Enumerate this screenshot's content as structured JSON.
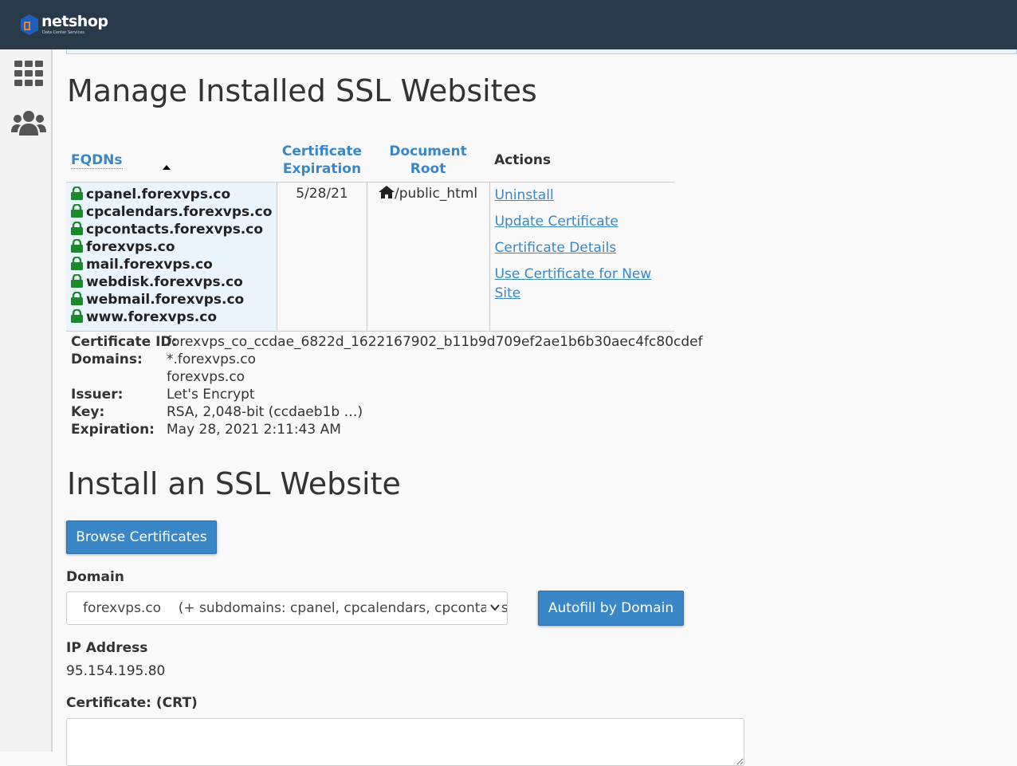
{
  "brand": {
    "name": "netshop",
    "tagline": "Data Center Services",
    "accent_color": "#3a87c8",
    "topbar_color": "#293a4a"
  },
  "sidebar": {
    "items": [
      {
        "icon": "grid-icon"
      },
      {
        "icon": "users-icon"
      }
    ]
  },
  "page": {
    "title": "Manage Installed SSL Websites",
    "install_title": "Install an SSL Website"
  },
  "table": {
    "headers": {
      "fqdns": "FQDNs",
      "expiration": "Certificate Expiration",
      "document_root": "Document Root",
      "actions": "Actions"
    },
    "row": {
      "fqdns": [
        "cpanel.forexvps.co",
        "cpcalendars.forexvps.co",
        "cpcontacts.forexvps.co",
        "forexvps.co",
        "mail.forexvps.co",
        "webdisk.forexvps.co",
        "webmail.forexvps.co",
        "www.forexvps.co"
      ],
      "expiration": "5/28/21",
      "document_root": "/public_html",
      "actions": [
        "Uninstall",
        "Update Certificate",
        "Certificate Details",
        "Use Certificate for New Site"
      ]
    }
  },
  "cert": {
    "id_label": "Certificate ID:",
    "id_value": "forexvps_co_ccdae_6822d_1622167902_b11b9d709ef2ae1b6b30aec4fc80cdef",
    "domains_label": "Domains:",
    "domains": [
      "*.forexvps.co",
      "forexvps.co"
    ],
    "issuer_label": "Issuer:",
    "issuer_value": "Let's Encrypt",
    "key_label": "Key:",
    "key_value": "RSA, 2,048-bit (ccdaeb1b …)",
    "expiration_label": "Expiration:",
    "expiration_value": "May 28, 2021 2:11:43 AM"
  },
  "install": {
    "browse_label": "Browse Certificates",
    "domain_label": "Domain",
    "domain_selected": "forexvps.co    (+ subdomains: cpanel, cpcalendars, cpcontacts, mail, webdisk, webmail, www)",
    "autofill_label": "Autofill by Domain",
    "ip_label": "IP Address",
    "ip_value": "95.154.195.80",
    "crt_label": "Certificate: (CRT)",
    "crt_value": ""
  }
}
